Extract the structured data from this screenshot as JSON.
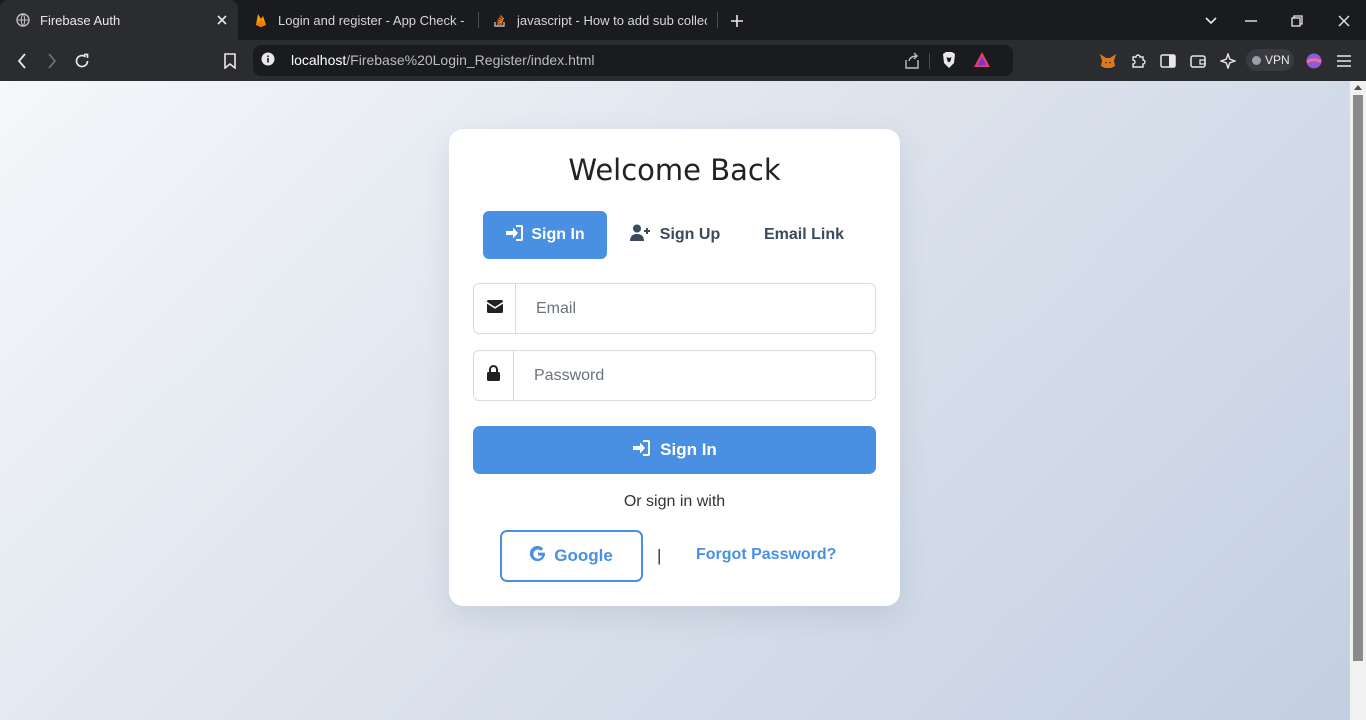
{
  "browser": {
    "tabs": [
      {
        "title": "Firebase Auth",
        "favicon": "globe-icon",
        "active": true
      },
      {
        "title": "Login and register - App Check - Fir",
        "favicon": "firebase-icon"
      },
      {
        "title": "javascript - How to add sub collectio",
        "favicon": "stackoverflow-icon"
      }
    ],
    "url_host": "localhost",
    "url_path": "/Firebase%20Login_Register/index.html",
    "vpn_label": "VPN"
  },
  "card": {
    "title": "Welcome Back",
    "tabs": {
      "signin": "Sign In",
      "signup": "Sign Up",
      "email_link": "Email Link"
    },
    "email_placeholder": "Email",
    "password_placeholder": "Password",
    "submit_label": "Sign In",
    "or_text": "Or sign in with",
    "google_label": "Google",
    "separator": "|",
    "forgot_label": "Forgot Password?"
  },
  "colors": {
    "accent": "#4a90e2",
    "text_dark": "#222222",
    "tab_text": "#3b4a5e"
  }
}
